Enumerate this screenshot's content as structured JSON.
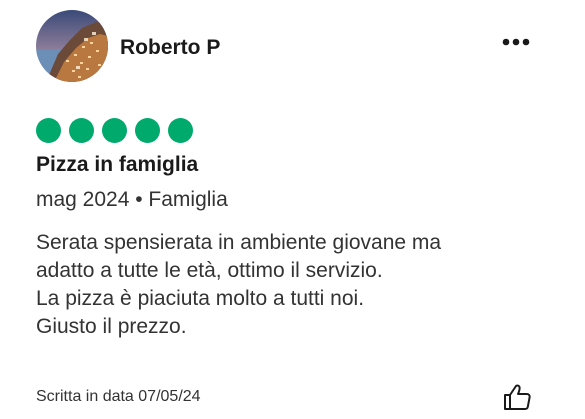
{
  "review": {
    "author": {
      "name": "Roberto P"
    },
    "rating": {
      "value": 5,
      "max": 5,
      "color": "#00aa6c"
    },
    "title": "Pizza in famiglia",
    "meta": "mag 2024 • Famiglia",
    "body_lines": [
      "Serata spensierata in ambiente giovane ma",
      "adatto a tutte le età, ottimo il servizio.",
      "La pizza è piaciuta molto a tutti noi.",
      "Giusto il prezzo."
    ],
    "written_date": "Scritta in data 07/05/24"
  },
  "icons": {
    "more": "more-options-icon",
    "like": "thumbs-up-icon"
  }
}
